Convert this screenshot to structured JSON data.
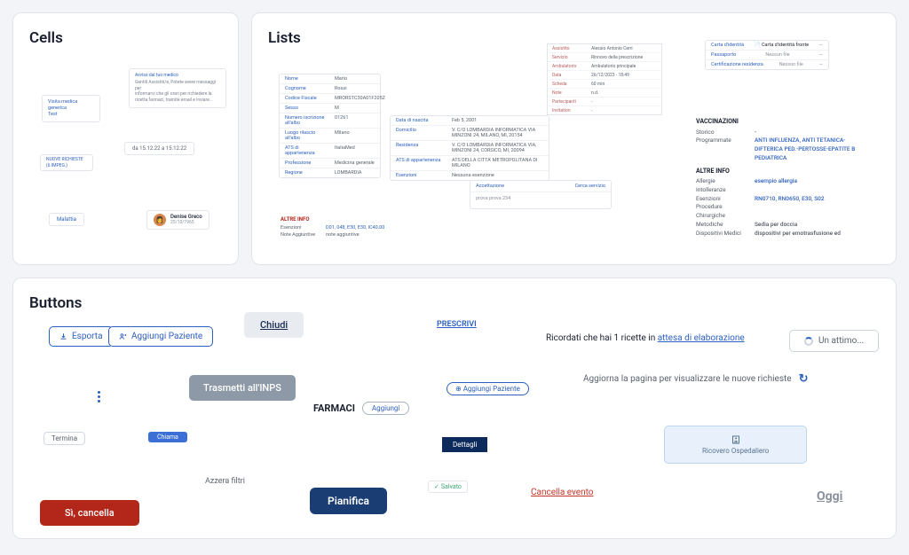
{
  "sections": {
    "cells": "Cells",
    "lists": "Lists",
    "buttons": "Buttons"
  },
  "cells": {
    "visit": {
      "line1": "Visita medica generica",
      "line2": "Test"
    },
    "memo": {
      "title": "Avviso dal tuo medico",
      "body1": "Gentili Assistiti/e, Potete avere messaggi per",
      "body2": "informarvi che gli orari per richiedere la",
      "body3": "ricetta farmaci, tramite email e inviare..."
    },
    "daterange": "da 15.12.22 a 15.12.22",
    "strip": {
      "a": "NUOVE RICHIESTE (6 IMPEG.)",
      "b": ""
    },
    "chip": "Malattia",
    "person": {
      "name": "Denise Greco",
      "date": "25/10/1965"
    }
  },
  "table1": {
    "rows": [
      [
        "Nome",
        "Mario"
      ],
      [
        "Cognome",
        "Rossi"
      ],
      [
        "Codice Fiscale",
        "MRORSTC30A01F205Z"
      ],
      [
        "Sesso",
        "M"
      ],
      [
        "Numero iscrizione all'albo",
        "01261"
      ],
      [
        "Luogo rilascio all'albo",
        "Milano"
      ],
      [
        "ATS di appartenenza",
        "ItaliaMed"
      ],
      [
        "Professione",
        "Medicina generale"
      ],
      [
        "Regione",
        "LOMBARDIA"
      ]
    ]
  },
  "tableAssist": {
    "rows": [
      [
        "Assistito",
        "Alessio Antonio Cerri"
      ],
      [
        "Servizio",
        "Rinnovo della prescrizione"
      ],
      [
        "Ambulatorio",
        "Ambulatorio principale"
      ],
      [
        "Data",
        "26/12/2023 - 18:49"
      ],
      [
        "Scheda",
        "60 min"
      ],
      [
        "Note",
        "n.d."
      ],
      [
        "Partecipanti",
        "-"
      ],
      [
        "Invitation",
        "-"
      ]
    ]
  },
  "table2": {
    "rows": [
      [
        "Data di nascita",
        "Feb 5, 2001"
      ],
      [
        "Domicilio",
        "V. C/O LOMBARDIA INFORMATICA VIA MINZONI 24, MILANO, MI, 20154"
      ],
      [
        "Residenza",
        "V. C/O LOMBARDIA INFORMATICA VIA, MINZONI 24, CORSICO, MI, 20094"
      ],
      [
        "ATS di appartenenza",
        "ATS DELLA CITTA' METROPOLITANA DI MILANO"
      ],
      [
        "Esenzioni",
        "Nessuna esenzione"
      ]
    ]
  },
  "idcard": {
    "rows": [
      [
        "Carta d'identità",
        "Carta d'identità fronte"
      ],
      [
        "Passaporto",
        "Nessun file"
      ],
      [
        "Certificazione residenza",
        "Nessun file"
      ]
    ]
  },
  "vacc": {
    "hd1": "VACCINAZIONI",
    "storico_k": "Storico",
    "storico_v": "-",
    "prog_k": "Programmate",
    "prog_v": "ANTI INFLUENZA, ANTI TETANICA-DIFTERICA PED.-PERTOSSE-EPATITE B PEDIATRICA",
    "hd2": "ALTRE INFO",
    "lines": [
      [
        "Allergie",
        "esempio allergia"
      ],
      [
        "Intolleranze",
        ""
      ],
      [
        "Esenzioni",
        "RN0710, RN0650, E30, S02"
      ],
      [
        "Procedure",
        ""
      ],
      [
        "Chirurgiche",
        ""
      ],
      [
        "Metodiche",
        "Sedia per doccia"
      ],
      [
        "Dispositivi Medici",
        "dispositivi per emotrasfusione ed"
      ]
    ]
  },
  "strip2": {
    "left": "Accettazione",
    "right": "Cerca servizio",
    "bottom": "prova prova 234"
  },
  "altre": {
    "hd": "ALTRE INFO",
    "l1k": "Esenzioni",
    "l1v": "D01, 048, E30, E30, IC40.00",
    "l2k": "Note Aggiuntive",
    "l2v": "note aggiuntive"
  },
  "buttons": {
    "esporta": "Esporta",
    "aggiungi_paziente": "Aggiungi Paziente",
    "chiudi": "Chiudi",
    "prescrivi": "PRESCRIVI",
    "ricette_pre": "Ricordati che hai 1 ricette in ",
    "ricette_link": "attesa di elaborazione",
    "un_attimo": "Un attimo...",
    "trasmetti": "Trasmetti all'INPS",
    "farmaci": "FARMACI",
    "aggiungi": "Aggiungi",
    "aggiungi_paziente_pill": "Aggiungi Paziente",
    "aggiorna": "Aggiorna la pagina per visualizzare le nuove richieste",
    "termina": "Termina",
    "chiama": "Chiama",
    "dettagli": "Dettagli",
    "ricovero": "Ricovero Ospedaliero",
    "azzera": "Azzera filtri",
    "salva": "Salvato",
    "cancella_evento": "Cancella evento",
    "oggi": "Oggi",
    "si_cancella": "Sì, cancella",
    "pianifica": "Pianifica"
  }
}
